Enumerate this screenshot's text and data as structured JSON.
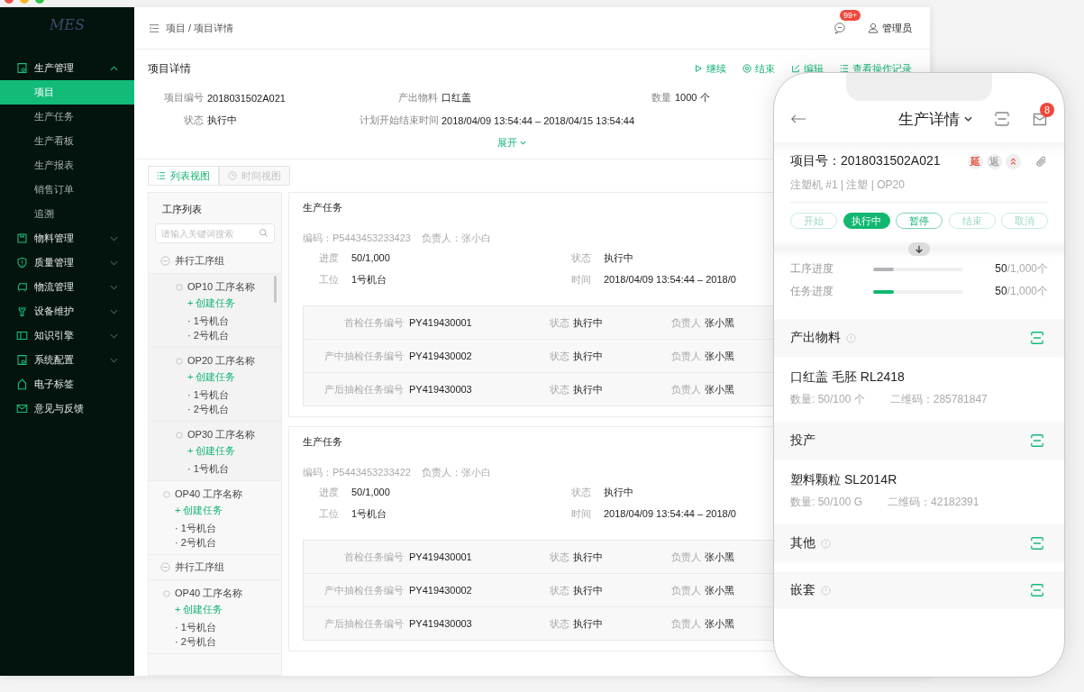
{
  "window": {
    "logo": "MES"
  },
  "sidebar": {
    "items": [
      {
        "label": "生产管理",
        "expanded": true,
        "children": [
          {
            "label": "项目",
            "selected": true
          },
          {
            "label": "生产任务",
            "selected": false
          },
          {
            "label": "生产看板",
            "selected": false
          },
          {
            "label": "生产报表",
            "selected": false
          },
          {
            "label": "销售订单",
            "selected": false
          },
          {
            "label": "追溯",
            "selected": false
          }
        ]
      },
      {
        "label": "物料管理",
        "expanded": false
      },
      {
        "label": "质量管理",
        "expanded": false
      },
      {
        "label": "物流管理",
        "expanded": false
      },
      {
        "label": "设备维护",
        "expanded": false
      },
      {
        "label": "知识引擎",
        "expanded": false
      },
      {
        "label": "系统配置",
        "expanded": false
      },
      {
        "label": "电子标签"
      },
      {
        "label": "意见与反馈"
      }
    ]
  },
  "header": {
    "breadcrumb": "项目 / 项目详情",
    "badge": "99+",
    "user": "管理员"
  },
  "detail": {
    "title": "项目详情",
    "actions": [
      "继续",
      "结束",
      "编辑",
      "查看操作记录"
    ],
    "fields": [
      {
        "label": "项目编号",
        "value": "2018031502A021"
      },
      {
        "label": "产出物料",
        "value": "口红盖"
      },
      {
        "label": "数量",
        "value": "1000 个"
      },
      {
        "label": "状态",
        "value": "执行中"
      },
      {
        "label": "计划开始结束时间",
        "value": "2018/04/09 13:54:44 – 2018/04/15 13:54:44"
      }
    ],
    "expand": "展开"
  },
  "view_tabs": [
    {
      "label": "列表视图",
      "selected": true
    },
    {
      "label": "时间视图",
      "selected": false
    }
  ],
  "process_list": {
    "title": "工序列表",
    "placeholder": "请输入关键词搜索",
    "items": [
      {
        "kind": "group",
        "label": "并行工序组",
        "children": [
          {
            "kind": "step",
            "name": "OP10 工序名称",
            "action": "+ 创建任务",
            "machines": [
              "· 1号机台",
              "· 2号机台"
            ]
          },
          {
            "kind": "step",
            "name": "OP20 工序名称",
            "action": "+ 创建任务",
            "machines": [
              "· 1号机台",
              "· 2号机台"
            ]
          },
          {
            "kind": "step",
            "name": "OP30 工序名称",
            "action": "+ 创建任务",
            "machines": [
              "· 1号机台"
            ]
          }
        ]
      },
      {
        "kind": "step",
        "name": "OP40 工序名称",
        "action": "+ 创建任务",
        "machines": [
          "· 1号机台",
          "· 2号机台"
        ]
      },
      {
        "kind": "group",
        "label": "并行工序组"
      },
      {
        "kind": "step",
        "name": "OP40 工序名称",
        "action": "+ 创建任务",
        "machines": [
          "· 1号机台",
          "· 2号机台"
        ]
      }
    ]
  },
  "tasks": [
    {
      "title": "生产任务",
      "code": "编码：P5443453233423",
      "owner": "负责人：张小白",
      "fields": [
        {
          "label": "进度",
          "value": "50/1,000"
        },
        {
          "label": "状态",
          "value": "执行中"
        },
        {
          "label": "工位",
          "value": "1号机台"
        },
        {
          "label": "时间",
          "value": "2018/04/09 13:54:44 – 2018/0"
        }
      ],
      "inspections": [
        {
          "label": "首检任务编号",
          "code": "PY419430001",
          "status_label": "状态",
          "status": "执行中",
          "owner_label": "负责人",
          "owner": "张小黑"
        },
        {
          "label": "产中抽检任务编号",
          "code": "PY419430002",
          "status_label": "状态",
          "status": "执行中",
          "owner_label": "负责人",
          "owner": "张小黑"
        },
        {
          "label": "产后抽检任务编号",
          "code": "PY419430003",
          "status_label": "状态",
          "status": "执行中",
          "owner_label": "负责人",
          "owner": "张小黑"
        }
      ]
    },
    {
      "title": "生产任务",
      "code": "编码：P5443453233422",
      "owner": "负责人：张小白",
      "fields": [
        {
          "label": "进度",
          "value": "50/1,000"
        },
        {
          "label": "状态",
          "value": "执行中"
        },
        {
          "label": "工位",
          "value": "1号机台"
        },
        {
          "label": "时间",
          "value": "2018/04/09 13:54:44 – 2018/0"
        }
      ],
      "inspections": [
        {
          "label": "首检任务编号",
          "code": "PY419430001",
          "status_label": "状态",
          "status": "执行中",
          "owner_label": "负责人",
          "owner": "张小黑"
        },
        {
          "label": "产中抽检任务编号",
          "code": "PY419430002",
          "status_label": "状态",
          "status": "执行中",
          "owner_label": "负责人",
          "owner": "张小黑"
        },
        {
          "label": "产后抽检任务编号",
          "code": "PY419430003",
          "status_label": "状态",
          "status": "执行中",
          "owner_label": "负责人",
          "owner": "张小黑"
        }
      ]
    }
  ],
  "phone": {
    "title": "生产详情",
    "badge": "8",
    "project": "项目号：2018031502A021",
    "tags": [
      {
        "label": "延",
        "color": "#e8473b"
      },
      {
        "label": "返",
        "color": "#a8a8a8"
      }
    ],
    "subtitle": "注塑机 #1 | 注塑 | OP20",
    "statuses": [
      {
        "label": "开始",
        "selected": false,
        "disabled": true
      },
      {
        "label": "执行中",
        "selected": true,
        "disabled": false
      },
      {
        "label": "暂停",
        "selected": false,
        "disabled": false
      },
      {
        "label": "结束",
        "selected": false,
        "disabled": true
      },
      {
        "label": "取消",
        "selected": false,
        "disabled": true
      }
    ],
    "progress": [
      {
        "label": "工序进度",
        "level": 0.23,
        "color": "#b4b4b8",
        "reading": "**50**/1,000个"
      },
      {
        "label": "任务进度",
        "level": 0.23,
        "color": "#12b870",
        "reading": "**50**/1,000个"
      }
    ],
    "sections": [
      {
        "title": "产出物料",
        "info": true,
        "items": [
          {
            "name": "口红盖 毛胚 RL2418",
            "qty": "数量: 50/100 个",
            "code": "二维码：285781847"
          }
        ]
      },
      {
        "title": "投产",
        "info": false,
        "items": [
          {
            "name": "塑料颗粒 SL2014R",
            "qty": "数量: 50/100 G",
            "code": "二维码：42182391"
          }
        ]
      },
      {
        "title": "其他",
        "info": true
      },
      {
        "title": "嵌套",
        "info": true
      }
    ]
  }
}
